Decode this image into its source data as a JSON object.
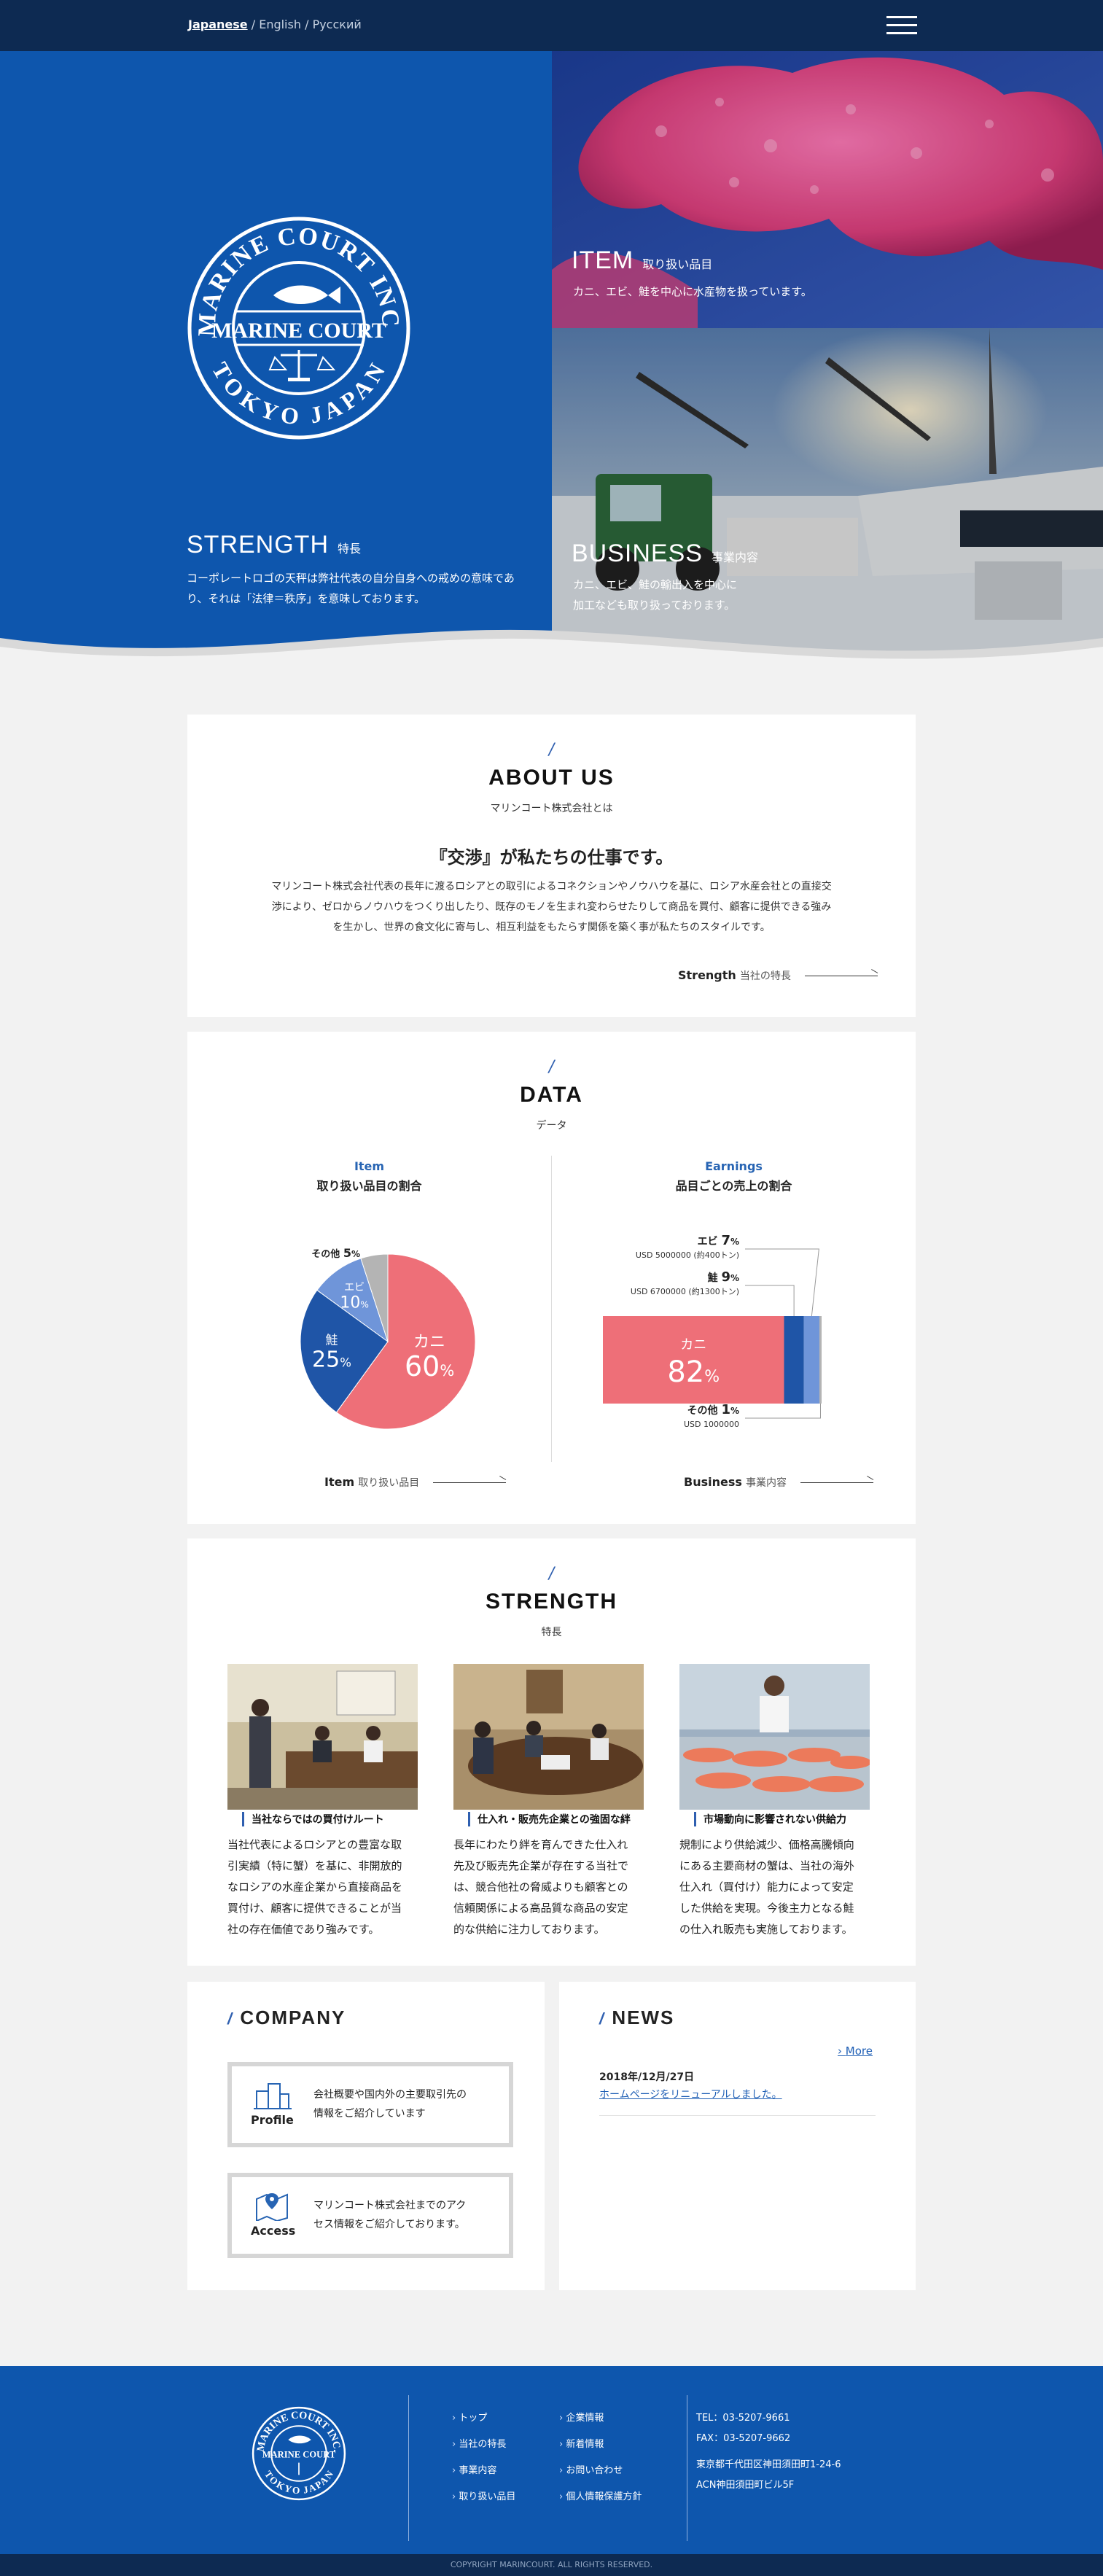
{
  "header": {
    "lang_japanese": "Japanese",
    "lang_english": "English",
    "lang_russian": "Русский",
    "sep": "/"
  },
  "hero": {
    "logo_text_top": "MARINE COURT INC.",
    "logo_text_mid": "MARINE COURT",
    "logo_text_bottom": "TOKYO JAPAN",
    "strength_title": "STRENGTH",
    "strength_sub": "特長",
    "strength_line1": "コーポレートロゴの天秤は弊社代表の自分自身への戒めの意味であ",
    "strength_line2": "り、それは「法律＝秩序」を意味しております。",
    "item_title": "ITEM",
    "item_sub": "取り扱い品目",
    "item_desc": "カニ、エビ、鮭を中心に水産物を扱っています。",
    "business_title": "BUSINESS",
    "business_sub": "事業内容",
    "business_line1": "カニ、エビ、鮭の輸出入を中心に",
    "business_line2": "加工なども取り扱っております。"
  },
  "about": {
    "title": "ABOUT US",
    "sub": "マリンコート株式会社とは",
    "headline": "『交渉』が私たちの仕事です。",
    "line1": "マリンコート株式会社代表の長年に渡るロシアとの取引によるコネクションやノウハウを基に、ロシア水産会社との直接交",
    "line2": "渉により、ゼロからノウハウをつくり出したり、既存のモノを生まれ変わらせたりして商品を買付、顧客に提供できる強み",
    "line3": "を生かし、世界の食文化に寄与し、相互利益をもたらす関係を築く事が私たちのスタイルです。",
    "link_en": "Strength",
    "link_jp": "当社の特長"
  },
  "data_section": {
    "title": "DATA",
    "sub": "データ",
    "left_heading_en": "Item",
    "left_heading_jp": "取り扱い品目の割合",
    "right_heading_en": "Earnings",
    "right_heading_jp": "品目ごとの売上の割合",
    "left_link_en": "Item",
    "left_link_jp": "取り扱い品目",
    "right_link_en": "Business",
    "right_link_jp": "事業内容",
    "pct": "%",
    "colors": {
      "crab": "#ee6f78",
      "salmon": "#1f55a7",
      "shrimp": "#6f95d9",
      "other": "#b4b4b4"
    }
  },
  "chart_data": [
    {
      "type": "pie",
      "title": "取り扱い品目の割合",
      "categories": [
        "カニ",
        "鮭",
        "エビ",
        "その他"
      ],
      "values": [
        60,
        25,
        10,
        5
      ],
      "unit": "%"
    },
    {
      "type": "bar",
      "title": "品目ごとの売上の割合",
      "categories": [
        "カニ",
        "鮭",
        "エビ",
        "その他"
      ],
      "values": [
        82,
        9,
        7,
        1
      ],
      "unit": "%",
      "notes": {
        "shrimp": "USD 5000000 (約400トン)",
        "salmon": "USD 6700000 (約1300トン)",
        "other": "USD 1000000"
      }
    }
  ],
  "strength": {
    "title": "STRENGTH",
    "sub": "特長",
    "items": [
      {
        "caption": "当社ならではの買付けルート",
        "lines": [
          "当社代表によるロシアとの豊富な取",
          "引実績（特に蟹）を基に、非開放的",
          "なロシアの水産企業から直接商品を",
          "買付け、顧客に提供できることが当",
          "社の存在価値であり強みです。"
        ]
      },
      {
        "caption": "仕入れ・販売先企業との強固な絆",
        "lines": [
          "長年にわたり絆を育んできた仕入れ",
          "先及び販売先企業が存在する当社で",
          "は、競合他社の脅威よりも顧客との",
          "信頼関係による高品質な商品の安定",
          "的な供給に注力しております。"
        ]
      },
      {
        "caption": "市場動向に影響されない供給力",
        "lines": [
          "規制により供給減少、価格高騰傾向",
          "にある主要商材の蟹は、当社の海外",
          "仕入れ（買付け）能力によって安定",
          "した供給を実現。今後主力となる鮭",
          "の仕入れ販売も実施しております。"
        ]
      }
    ]
  },
  "company": {
    "title": "COMPANY",
    "profile_label": "Profile",
    "profile_line1": "会社概要や国内外の主要取引先の",
    "profile_line2": "情報をご紹介しています",
    "access_label": "Access",
    "access_line1": "マリンコート株式会社までのアク",
    "access_line2": "セス情報をご紹介しております。"
  },
  "news": {
    "title": "NEWS",
    "more": "More",
    "date": "2018年/12月/27日",
    "headline": "ホームページをリニューアルしました。"
  },
  "footer": {
    "nav_col1": [
      "トップ",
      "当社の特長",
      "事業内容",
      "取り扱い品目"
    ],
    "nav_col2": [
      "企業情報",
      "新着情報",
      "お問い合わせ",
      "個人情報保護方針"
    ],
    "tel": "TEL：03-5207-9661",
    "fax": "FAX：03-5207-9662",
    "address1": "東京都千代田区神田須田町1-24-6",
    "address2": "ACN神田須田町ビル5F",
    "copyright": "COPYRIGHT MARINCOURT. ALL RIGHTS RESERVED."
  }
}
